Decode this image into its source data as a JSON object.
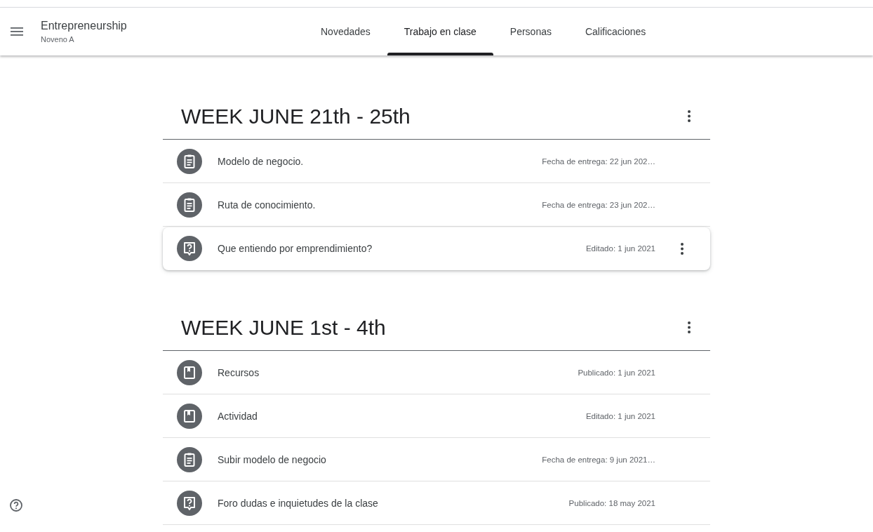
{
  "header": {
    "class_name": "Entrepreneurship",
    "section": "Noveno A"
  },
  "tabs": [
    {
      "label": "Novedades",
      "selected": false
    },
    {
      "label": "Trabajo en clase",
      "selected": true
    },
    {
      "label": "Personas",
      "selected": false
    },
    {
      "label": "Calificaciones",
      "selected": false
    }
  ],
  "topics": [
    {
      "title": "WEEK JUNE 21th - 25th",
      "items": [
        {
          "kind": "assignment",
          "title": "Modelo de negocio.",
          "date": "Fecha de entrega: 22 jun 202…",
          "hovered": false
        },
        {
          "kind": "assignment",
          "title": "Ruta de conocimiento.",
          "date": "Fecha de entrega: 23 jun 202…",
          "hovered": false
        },
        {
          "kind": "question",
          "title": "Que entiendo por emprendimiento?",
          "date": "Editado: 1 jun 2021",
          "hovered": true
        }
      ]
    },
    {
      "title": "WEEK JUNE 1st - 4th",
      "items": [
        {
          "kind": "material",
          "title": "Recursos",
          "date": "Publicado: 1 jun 2021",
          "hovered": false
        },
        {
          "kind": "material",
          "title": "Actividad",
          "date": "Editado: 1 jun 2021",
          "hovered": false
        },
        {
          "kind": "assignment",
          "title": "Subir modelo de negocio",
          "date": "Fecha de entrega: 9 jun 2021…",
          "hovered": false
        },
        {
          "kind": "question",
          "title": "Foro dudas e inquietudes de la clase",
          "date": "Publicado: 18 may 2021",
          "hovered": false
        }
      ]
    }
  ]
}
